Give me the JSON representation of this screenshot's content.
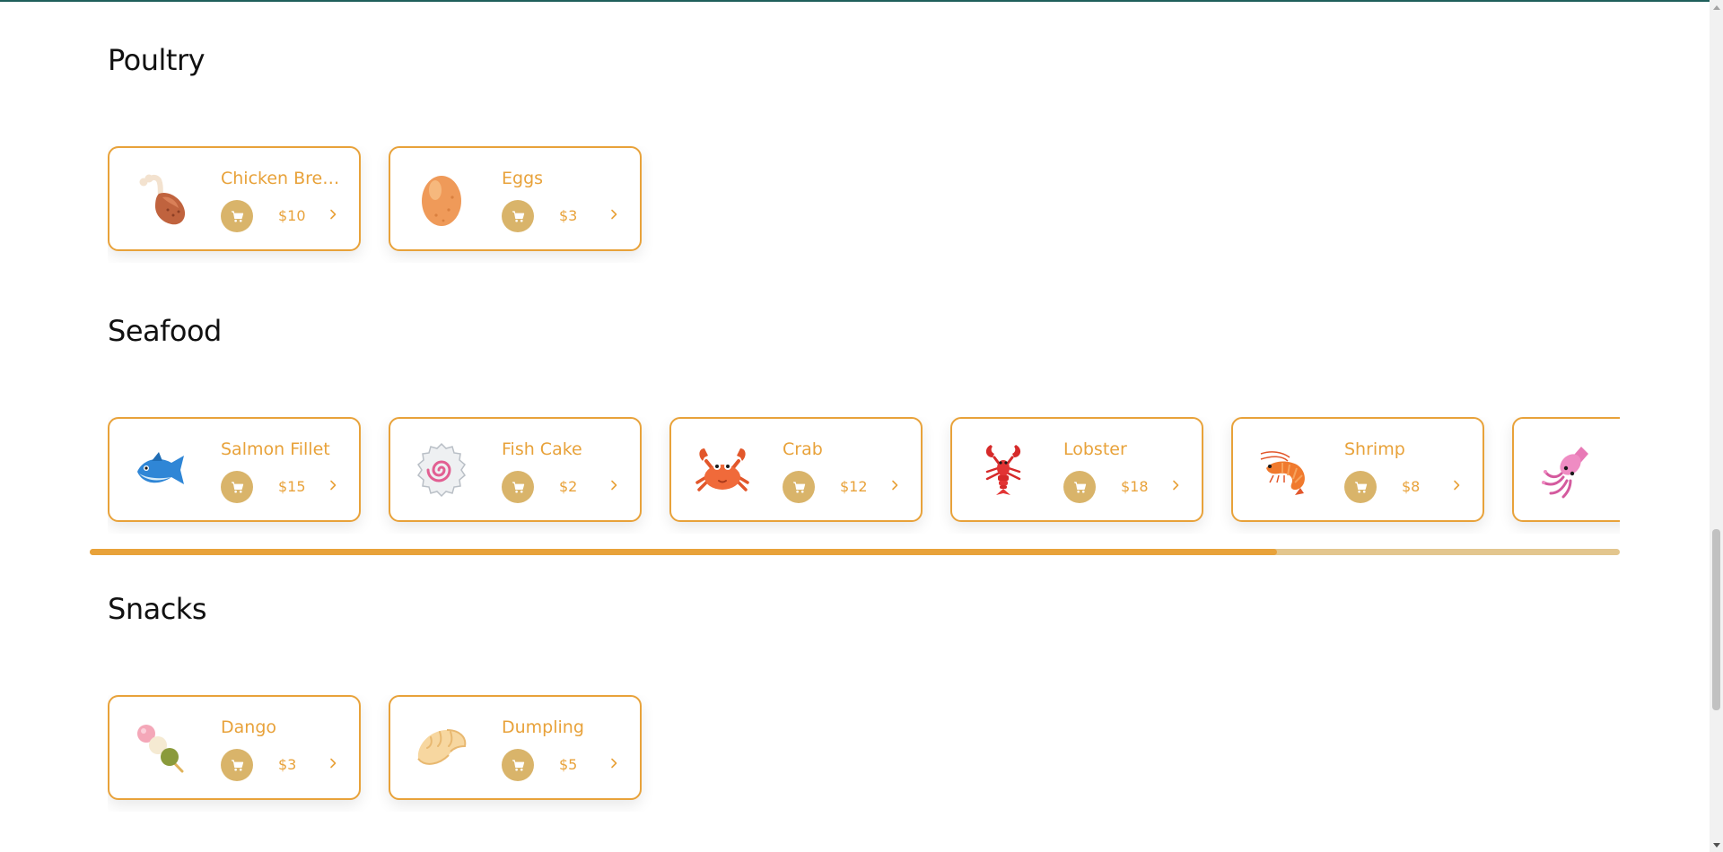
{
  "theme": {
    "accent": "#e8a23a",
    "cart_button_bg": "#d9b46a",
    "heading": "#111111",
    "top_border": "#1f5f5b"
  },
  "sections": [
    {
      "title": "Poultry",
      "items": [
        {
          "name": "Chicken Breast",
          "price": "$10",
          "icon": "poultry-leg-icon"
        },
        {
          "name": "Eggs",
          "price": "$3",
          "icon": "egg-icon"
        }
      ]
    },
    {
      "title": "Seafood",
      "items": [
        {
          "name": "Salmon Fillet",
          "price": "$15",
          "icon": "fish-icon"
        },
        {
          "name": "Fish Cake",
          "price": "$2",
          "icon": "fish-cake-icon"
        },
        {
          "name": "Crab",
          "price": "$12",
          "icon": "crab-icon"
        },
        {
          "name": "Lobster",
          "price": "$18",
          "icon": "lobster-icon"
        },
        {
          "name": "Shrimp",
          "price": "$8",
          "icon": "shrimp-icon"
        },
        {
          "name": "",
          "price": "",
          "icon": "squid-icon"
        }
      ],
      "scroll_position": 0.776
    },
    {
      "title": "Snacks",
      "items": [
        {
          "name": "Dango",
          "price": "$3",
          "icon": "dango-icon"
        },
        {
          "name": "Dumpling",
          "price": "$5",
          "icon": "dumpling-icon"
        }
      ]
    }
  ],
  "page_scroll_position": 0.62
}
